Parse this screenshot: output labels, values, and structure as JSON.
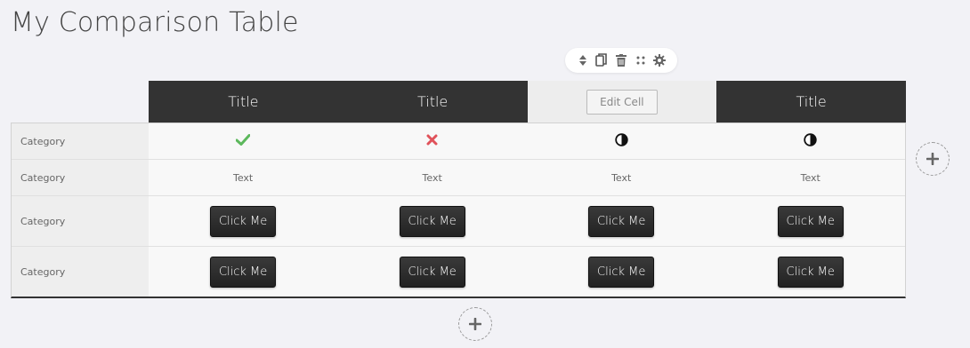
{
  "page": {
    "title": "My Comparison Table"
  },
  "toolbar": {
    "icons": [
      "sort-icon",
      "copy-icon",
      "trash-icon",
      "drag-handle-icon",
      "gear-icon"
    ]
  },
  "table": {
    "headers": [
      "Title",
      "Title",
      "Edit Cell",
      "Title"
    ],
    "editing_column": 2,
    "rows": [
      {
        "category": "Category",
        "type": "icons",
        "cells": [
          "check",
          "cross",
          "half-circle",
          "half-circle"
        ]
      },
      {
        "category": "Category",
        "type": "text",
        "cells": [
          "Text",
          "Text",
          "Text",
          "Text"
        ]
      },
      {
        "category": "Category",
        "type": "button",
        "cells": [
          "Click Me",
          "Click Me",
          "Click Me",
          "Click Me"
        ]
      },
      {
        "category": "Category",
        "type": "button",
        "cells": [
          "Click Me",
          "Click Me",
          "Click Me",
          "Click Me"
        ]
      }
    ]
  },
  "colors": {
    "header_bg": "#333333",
    "check": "#5cb85c",
    "cross": "#e0525a",
    "page_bg": "#f2f2f6"
  }
}
